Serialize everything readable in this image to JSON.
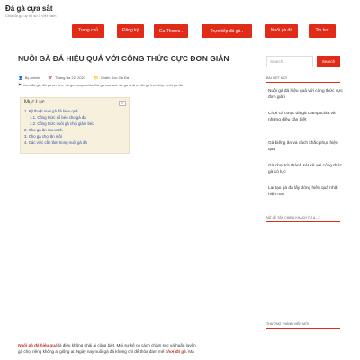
{
  "site": {
    "title": "Đá gà cựa sắt",
    "tagline": "Chia đá gà uy tín số 1 Việt Nam"
  },
  "nav": {
    "items": [
      {
        "label": "Trang chủ",
        "dropdown": false
      },
      {
        "label": "Đăng ký",
        "dropdown": false
      },
      {
        "label": "Ga Thomo",
        "dropdown": true
      },
      {
        "label": "Trực tiếp đá gà",
        "dropdown": true
      },
      {
        "label": "Nuôi gà đá",
        "dropdown": false
      },
      {
        "label": "Tin hot",
        "dropdown": false
      }
    ]
  },
  "post": {
    "title": "NUÔI GÀ ĐÁ HIỆU QUẢ VỚI CÔNG THỨC CỰC ĐƠN GIẢN",
    "author": "admin",
    "date": "Tháng Ba 22, 2021",
    "category": "Chăm Sóc Gà Đá",
    "tags": "chơi đá gà, đá ga an tien, da ga campuchia, Đá gà cua sat, da ga online, đá gà trực tiếp, nuôi gà đá"
  },
  "toc": {
    "heading": "Mục Lục",
    "items": [
      "1. Kỹ thuật nuôi gà đá hiệu quả",
      "1.1. Công thức xổ béo cho gà đá",
      "1.2. Công thức nuôi gà chọi giảm béo",
      "2. Cho gà ăn rau xanh",
      "3. Cho gà chọi ăn mồi",
      "4. Các việc cần làm trong nuôi gà đá"
    ]
  },
  "body": {
    "highlight1": "Nuôi gà đá hiệu quả",
    "line1_rest": " là điều không phải ai cũng biết. Mỗi sư kê có cách chăm sóc và huấn luyện",
    "line2_start": "gà chọi riêng không ai giống ai. Ngày nay nuôi gà đá không chỉ để thỏa đam mê ",
    "highlight2": "chơi đá gà",
    "line2_end": ". Mà"
  },
  "sidebar": {
    "search_placeholder": "Search",
    "search_button": "Search",
    "recent_heading": "BÀI VIẾT MỚI",
    "recent_posts": [
      "Nuôi gà đá hiệu quả với công thức cực đơn giản",
      "Chơi cá cược đá gà Campuchia và những điều cần biết",
      "Gà biếng ăn và cách khắc phục hiệu quả",
      "Gà chọi trờ thành sát kê với công thức gà có lực",
      "Lai tạo gà đá lấy dòng hiếu quả nhất hiện nay"
    ],
    "comments_heading": "NỮ LỄ TÂN CHIẾU KHÁCH TỪ A - Z",
    "members_heading": "THƯƠNG THÀNH VIÊN MỚI"
  },
  "icons": {
    "author": "user-icon",
    "date": "calendar-icon",
    "category": "folder-icon",
    "tags": "tag-icon",
    "toc_toggle": "list-icon"
  },
  "colors": {
    "accent": "#e12b19",
    "link": "#2a4fa5",
    "toc_bg": "#f6f0dd"
  }
}
